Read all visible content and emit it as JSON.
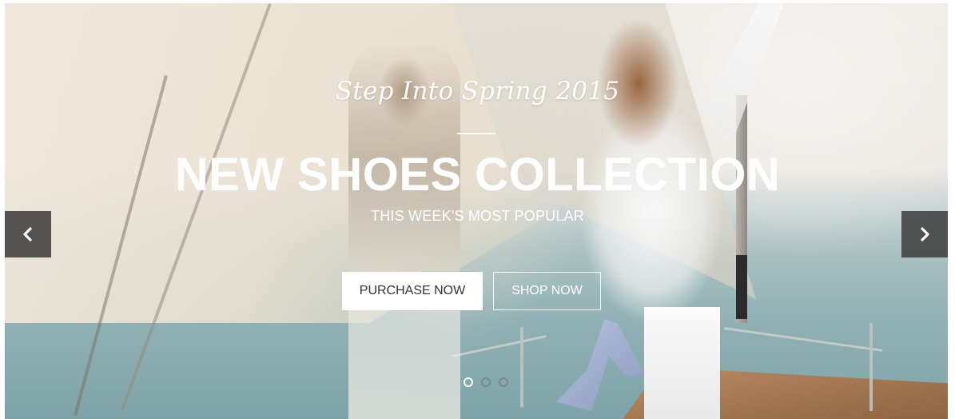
{
  "hero": {
    "tagline": "Step Into Spring 2015",
    "headline": "NEW SHOES COLLECTION",
    "subheadline": "THIS WEEK'S MOST POPULAR",
    "primary_button": "PURCHASE NOW",
    "secondary_button": "SHOP NOW"
  },
  "slider": {
    "prev_icon": "chevron-left-icon",
    "next_icon": "chevron-right-icon",
    "slide_count": 3,
    "active_slide": 1
  },
  "colors": {
    "text": "#ffffff",
    "button_text": "#333333",
    "arrow_bg": "#464646"
  }
}
